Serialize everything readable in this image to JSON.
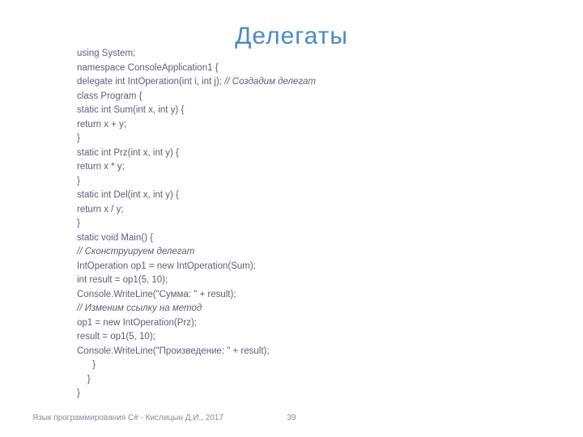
{
  "title": "Делегаты",
  "code": {
    "l1": "using System;",
    "l2": "namespace ConsoleApplication1 {",
    "l3a": "delegate int IntOperation(int i, int j); ",
    "l3b": "// Создадим делегат",
    "l4": "class Program {",
    "l5": "static int Sum(int x, int y) {",
    "l6": "return x + y;",
    "l7": "}",
    "l8": "static int Prz(int x, int y) {",
    "l9": "return x * y;",
    "l10": "}",
    "l11": "static int Del(int x, int y) {",
    "l12": "return x / y;",
    "l13": "}",
    "l14": "static void Main() {",
    "l15": "// Сконструируем делегат",
    "l16": "IntOperation op1 = new IntOperation(Sum);",
    "l17": "int result = op1(5, 10);",
    "l18": "Console.WriteLine(\"Сумма: \" + result);",
    "l19": "// Изменим ссылку на метод",
    "l20": "op1 = new IntOperation(Prz);",
    "l21": "result = op1(5, 10);",
    "l22": "Console.WriteLine(\"Произведение: \" + result);",
    "l23": "      }",
    "l24": "    }",
    "l25": "}"
  },
  "footer": "Язык программирования C# - Кислицын Д.И., 2017",
  "page_number": "39"
}
